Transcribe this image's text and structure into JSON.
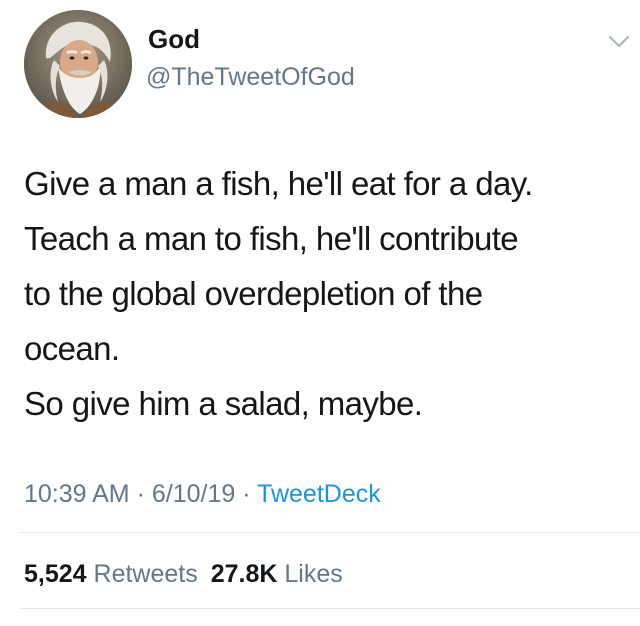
{
  "author": {
    "display_name": "God",
    "handle": "@TheTweetOfGod",
    "avatar_icon": "bearded-man-avatar"
  },
  "menu": {
    "icon": "chevron-down-icon"
  },
  "tweet": {
    "lines": [
      "Give a man a fish, he'll eat for a day.",
      "Teach a man to fish, he'll contribute",
      "to the global overdepletion of the",
      "ocean.",
      "So give him a salad, maybe."
    ]
  },
  "meta": {
    "time": "10:39 AM",
    "date": "6/10/19",
    "separator": "·",
    "source": "TweetDeck"
  },
  "stats": {
    "retweets_count": "5,524",
    "retweets_label": "Retweets",
    "likes_count": "27.8K",
    "likes_label": "Likes"
  },
  "colors": {
    "text": "#14171a",
    "secondary": "#657786",
    "link": "#1b95e0",
    "divider": "#e1e8ed"
  }
}
